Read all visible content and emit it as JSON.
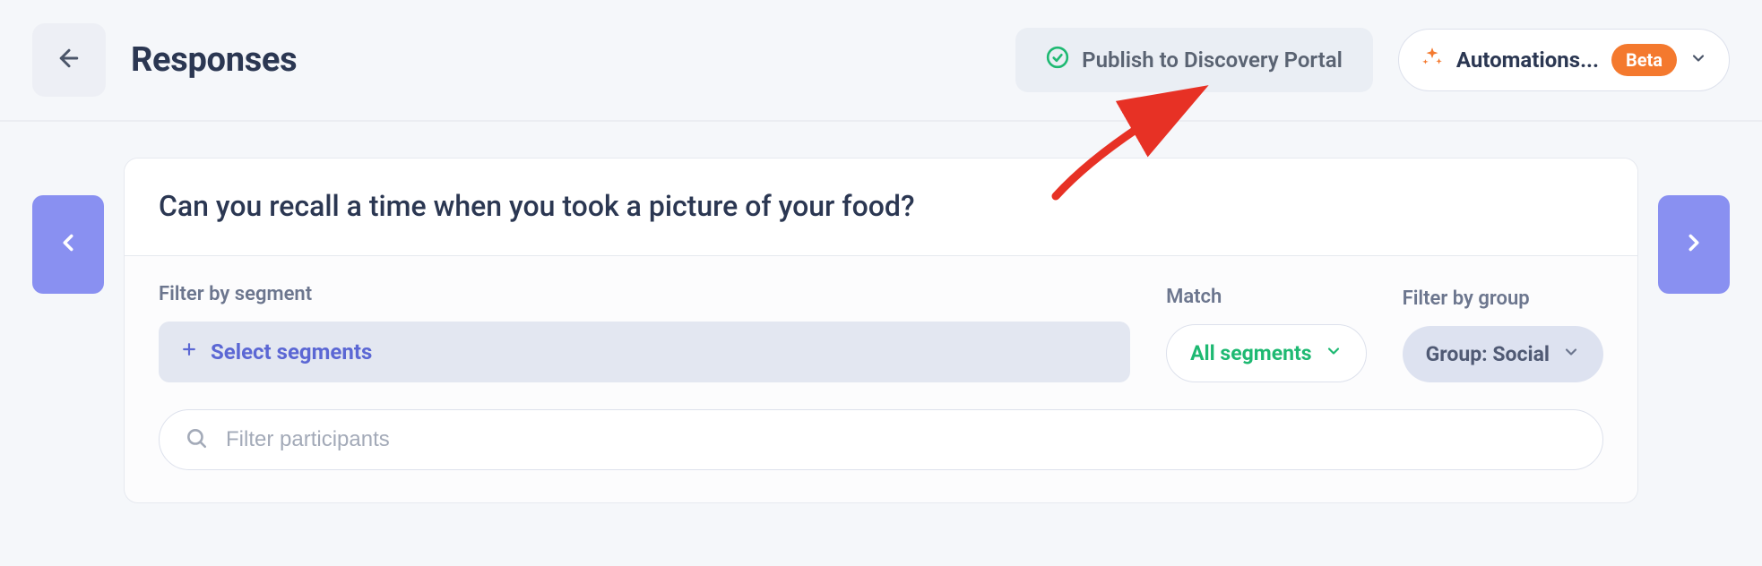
{
  "header": {
    "title": "Responses",
    "publish_label": "Publish to Discovery Portal",
    "automations_label": "Automations...",
    "automations_badge": "Beta"
  },
  "question": {
    "title": "Can you recall a time when you took a picture of your food?"
  },
  "filters": {
    "segment_label": "Filter by segment",
    "select_segments_label": "Select segments",
    "match_label": "Match",
    "match_value": "All segments",
    "group_label": "Filter by group",
    "group_value": "Group: Social"
  },
  "search": {
    "placeholder": "Filter participants"
  }
}
